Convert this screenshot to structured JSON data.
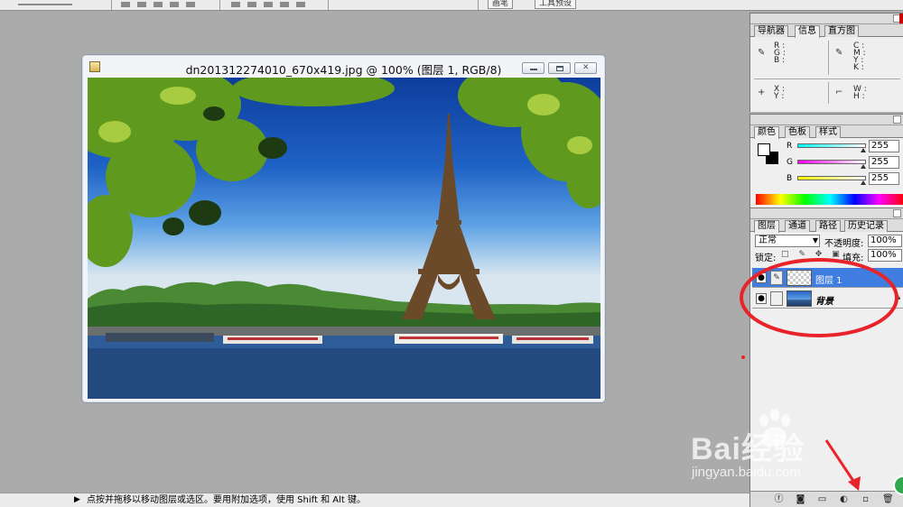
{
  "document": {
    "title": "dn201312274010_670x419.jpg @ 100% (图层 1, RGB/8)"
  },
  "top_strip": {
    "tabs": [
      "画笔",
      "工具预设"
    ]
  },
  "info_panel": {
    "tabs": [
      "导航器",
      "信息",
      "直方图"
    ],
    "active_tab": "信息",
    "rgb_labels": "R :\nG :\nB :",
    "cmyk_labels": "C :\nM :\nY :\nK :",
    "xy_labels": "X :\nY :",
    "wh_labels": "W :\nH :"
  },
  "color_panel": {
    "tabs": [
      "颜色",
      "色板",
      "样式"
    ],
    "active_tab": "颜色",
    "channels": [
      {
        "label": "R",
        "value": "255"
      },
      {
        "label": "G",
        "value": "255"
      },
      {
        "label": "B",
        "value": "255"
      }
    ],
    "foreground": "#ffffff",
    "background": "#000000"
  },
  "layers_panel": {
    "tabs": [
      "图层",
      "通道",
      "路径",
      "历史记录"
    ],
    "active_tab": "图层",
    "blend_mode": "正常",
    "opacity_label": "不透明度:",
    "opacity_value": "100%",
    "lock_label": "锁定:",
    "fill_label": "填充:",
    "fill_value": "100%",
    "layers": [
      {
        "name": "图层 1",
        "selected": true
      },
      {
        "name": "背景",
        "selected": false,
        "locked": true
      }
    ]
  },
  "status_bar": {
    "message": "点按并拖移以移动图层或选区。要用附加选项，使用 Shift 和 Alt 键。"
  },
  "watermark": {
    "brand": "Bai经验",
    "url": "jingyan.baidu.com"
  },
  "colors": {
    "annotation_red": "#e8232a",
    "selection_blue": "#3f7ee0"
  }
}
